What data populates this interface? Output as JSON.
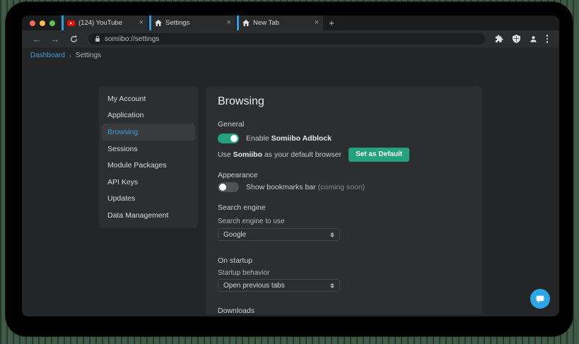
{
  "browser": {
    "tabs": [
      {
        "label": "(124) YouTube",
        "icon": "youtube-icon"
      },
      {
        "label": "Settings",
        "icon": "home-icon"
      },
      {
        "label": "New Tab",
        "icon": "home-icon"
      }
    ],
    "close_glyph": "×",
    "new_tab_glyph": "+",
    "nav": {
      "back_glyph": "←",
      "forward_glyph": "→"
    },
    "address": {
      "url": "somiibo://settings"
    }
  },
  "breadcrumb": {
    "link": "Dashboard",
    "separator": "›",
    "current": "Settings"
  },
  "sidebar": {
    "items": [
      {
        "label": "My Account"
      },
      {
        "label": "Application"
      },
      {
        "label": "Browsing"
      },
      {
        "label": "Sessions"
      },
      {
        "label": "Module Packages"
      },
      {
        "label": "API Keys"
      },
      {
        "label": "Updates"
      },
      {
        "label": "Data Management"
      }
    ],
    "active_item": "Browsing"
  },
  "settings": {
    "title": "Browsing",
    "general": {
      "heading": "General",
      "adblock_toggle": {
        "state": "on",
        "label_prefix": "Enable ",
        "label_bold": "Somiibo Adblock"
      },
      "default_browser": {
        "prefix": "Use ",
        "bold": "Somiibo",
        "suffix": " as your default browser",
        "button_label": "Set as Default"
      }
    },
    "appearance": {
      "heading": "Appearance",
      "bookmarks_toggle": {
        "state": "off",
        "label": "Show bookmarks bar",
        "note": "(coming soon)"
      }
    },
    "search": {
      "heading": "Search engine",
      "field_label": "Search engine to use",
      "selected": "Google"
    },
    "startup": {
      "heading": "On startup",
      "field_label": "Startup behavior",
      "selected": "Open previous tabs"
    },
    "downloads": {
      "heading": "Downloads"
    }
  },
  "colors": {
    "accent_teal": "#24a27f",
    "link_blue": "#409dd8",
    "tab_accent": "#2aa0e4",
    "fab_blue": "#2aa7e4"
  }
}
